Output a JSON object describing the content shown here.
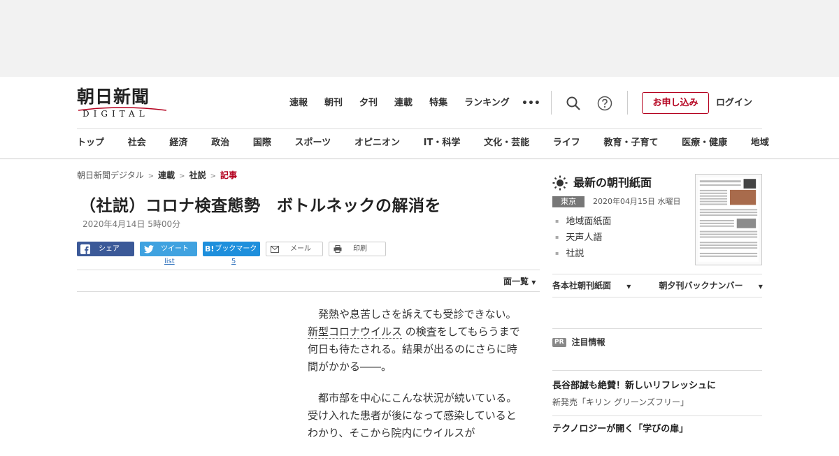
{
  "logo": {
    "jp": "朝日新聞",
    "en": "DIGITAL"
  },
  "topnav": [
    "速報",
    "朝刊",
    "夕刊",
    "連載",
    "特集",
    "ランキング"
  ],
  "more_label": "•••",
  "apply_label": "お申し込み",
  "login_label": "ログイン",
  "catnav": [
    "トップ",
    "社会",
    "経済",
    "政治",
    "国際",
    "スポーツ",
    "オピニオン",
    "IT・科学",
    "文化・芸能",
    "ライフ",
    "教育・子育て",
    "医療・健康",
    "地域"
  ],
  "breadcrumb": {
    "home": "朝日新聞デジタル",
    "serial": "連載",
    "editorial": "社説",
    "current": "記事"
  },
  "article": {
    "title": "（社説）コロナ検査態勢　ボトルネックの解消を",
    "date": "2020年4月14日 5時00分",
    "p1_pre": "発熱や息苦しさを訴えても受診できない。",
    "p1_kw": "新型コロナウイルス",
    "p1_post": "の検査をしてもらうまで何日も待たされる。結果が出るのにさらに時間がかかる――。",
    "p2": "都市部を中心にこんな状況が続いている。受け入れた患者が後になって感染しているとわかり、そこから院内にウイルスが"
  },
  "share": {
    "facebook": "シェア",
    "twitter": "ツイート",
    "hatena": "ブックマーク",
    "mail": "メール",
    "print": "印刷",
    "twitter_count": "list",
    "hatena_count": "5"
  },
  "menlist_label": "面一覧",
  "sidebar": {
    "title": "最新の朝刊紙面",
    "region_badge": "東京",
    "paper_date": "2020年04月15日 水曜日",
    "links": [
      "地域面紙面",
      "天声人語",
      "社説"
    ],
    "dropdown1": "各本社朝刊紙面",
    "dropdown2": "朝夕刊バックナンバー",
    "pr_badge": "PR",
    "pr_label": "注目情報",
    "promo1_title": "長谷部誠も絶賛！新しいリフレッシュに",
    "promo1_sub": "新発売「キリン グリーンズフリー」",
    "promo2_title": "テクノロジーが開く「学びの扉」"
  },
  "colors": {
    "brand_red": "#b4001e",
    "facebook": "#3b5998",
    "twitter": "#3fa2e0",
    "hatena": "#1e8fdc"
  }
}
